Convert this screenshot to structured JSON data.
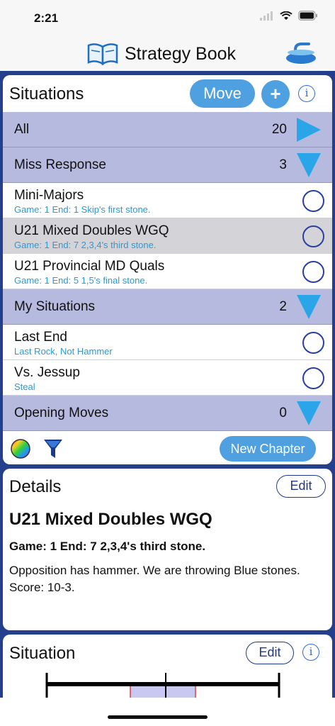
{
  "status": {
    "time": "2:21"
  },
  "nav": {
    "title": "Strategy Book"
  },
  "situations": {
    "title": "Situations",
    "move_label": "Move",
    "add_label": "+",
    "info_label": "i",
    "rows": {
      "all": {
        "label": "All",
        "count": "20"
      },
      "miss": {
        "label": "Miss Response",
        "count": "3"
      },
      "mini": {
        "title": "Mini-Majors",
        "sub": "Game: 1  End: 1  Skip's first stone."
      },
      "u21wgq": {
        "title": "U21 Mixed Doubles WGQ",
        "sub": "Game: 1  End: 7  2,3,4's third stone."
      },
      "u21prov": {
        "title": "U21 Provincial MD Quals",
        "sub": "Game: 1  End: 5  1,5's final stone."
      },
      "my": {
        "label": "My Situations",
        "count": "2"
      },
      "lastend": {
        "title": "Last End",
        "sub": "Last Rock, Not Hammer"
      },
      "jessup": {
        "title": "Vs. Jessup",
        "sub": "Steal"
      },
      "opening": {
        "label": "Opening Moves",
        "count": "0"
      }
    },
    "new_chapter_label": "New Chapter"
  },
  "details": {
    "title": "Details",
    "edit_label": "Edit",
    "name": "U21 Mixed Doubles WGQ",
    "meta": "Game: 1  End: 7  2,3,4's third stone.",
    "description": "Opposition has hammer. We are throwing Blue stones. Score: 10-3."
  },
  "situation": {
    "title": "Situation",
    "edit_label": "Edit",
    "info_label": "i"
  },
  "colors": {
    "frame": "#243f8c",
    "chapter": "#b7badf",
    "accent": "#4fa0e0",
    "triangle": "#2aa6e8",
    "subtitle": "#2a9ad6"
  }
}
